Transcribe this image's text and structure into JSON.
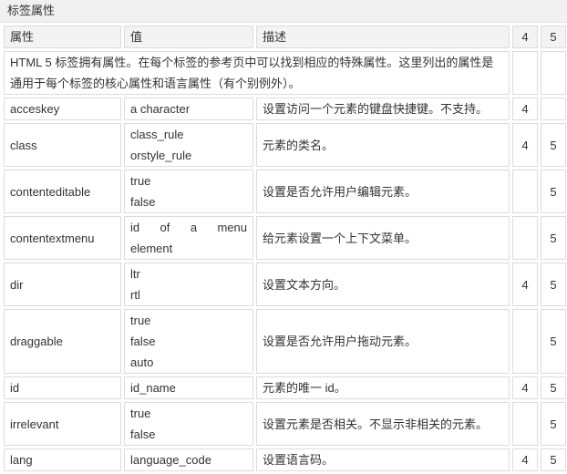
{
  "title": "标签属性",
  "headers": [
    "属性",
    "值",
    "描述",
    "4",
    "5"
  ],
  "intro": "HTML 5 标签拥有属性。在每个标签的参考页中可以找到相应的特殊属性。这里列出的属性是通用于每个标签的核心属性和语言属性（有个别例外）。",
  "rows": [
    {
      "attr": "acceskey",
      "values": [
        "a character"
      ],
      "desc": "设置访问一个元素的键盘快捷键。不支持。",
      "v4": "4",
      "v5": ""
    },
    {
      "attr": "class",
      "values": [
        "class_rule",
        "orstyle_rule"
      ],
      "desc": "元素的类名。",
      "v4": "4",
      "v5": "5"
    },
    {
      "attr": "contenteditable",
      "values": [
        "true",
        "false"
      ],
      "desc": "设置是否允许用户编辑元素。",
      "v4": "",
      "v5": "5"
    },
    {
      "attr": "contentextmenu",
      "values": [
        "id of a menu",
        "element"
      ],
      "desc": "给元素设置一个上下文菜单。",
      "v4": "",
      "v5": "5"
    },
    {
      "attr": "dir",
      "values": [
        "ltr",
        "rtl"
      ],
      "desc": "设置文本方向。",
      "v4": "4",
      "v5": "5"
    },
    {
      "attr": "draggable",
      "values": [
        "true",
        "false",
        "auto"
      ],
      "desc": "设置是否允许用户拖动元素。",
      "v4": "",
      "v5": "5"
    },
    {
      "attr": "id",
      "values": [
        "id_name"
      ],
      "desc": "元素的唯一 id。",
      "v4": "4",
      "v5": "5"
    },
    {
      "attr": "irrelevant",
      "values": [
        "true",
        "false"
      ],
      "desc": "设置元素是否相关。不显示非相关的元素。",
      "v4": "",
      "v5": "5"
    },
    {
      "attr": "lang",
      "values": [
        "language_code"
      ],
      "desc": "设置语言码。",
      "v4": "4",
      "v5": "5"
    }
  ]
}
